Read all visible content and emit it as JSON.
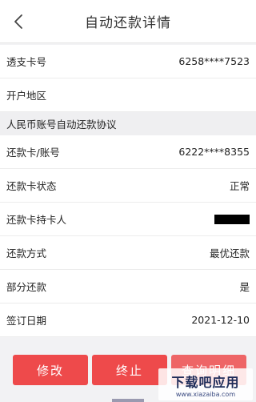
{
  "header": {
    "title": "自动还款详情"
  },
  "rows_top": [
    {
      "label": "透支卡号",
      "value": "6258****7523"
    },
    {
      "label": "开户地区",
      "value": ""
    }
  ],
  "section": {
    "title": "人民币账号自动还款协议"
  },
  "rows_main": [
    {
      "label": "还款卡/账号",
      "value": "6222****8355"
    },
    {
      "label": "还款卡状态",
      "value": "正常"
    },
    {
      "label": "还款卡持卡人",
      "value": ""
    },
    {
      "label": "还款方式",
      "value": "最优还款"
    },
    {
      "label": "部分还款",
      "value": "是"
    },
    {
      "label": "签订日期",
      "value": "2021-12-10"
    }
  ],
  "actions": {
    "modify": "修改",
    "stop": "终止",
    "detail": "查询明细"
  },
  "watermark": {
    "main": "下载吧应用",
    "sub": "www.xiazaiba.com"
  },
  "colors": {
    "accent": "#ee4a4b"
  }
}
